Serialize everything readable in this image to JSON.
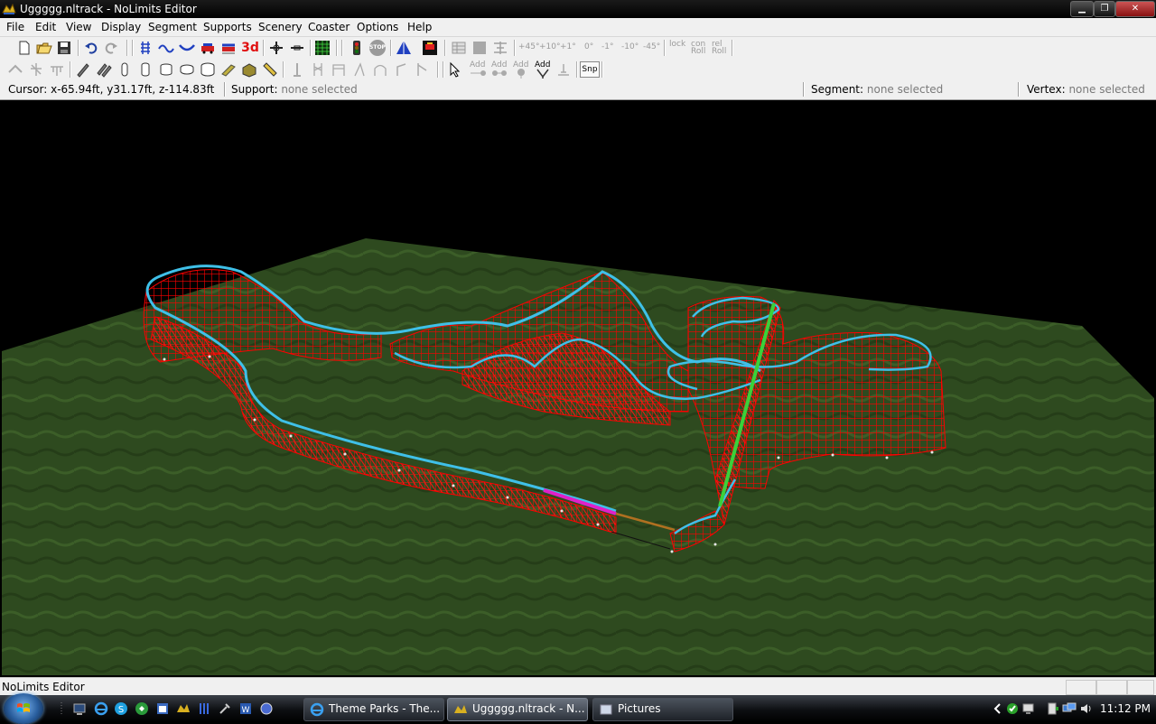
{
  "window": {
    "title": "Uggggg.nltrack - NoLimits Editor"
  },
  "menu": [
    "File",
    "Edit",
    "View",
    "Display",
    "Segment",
    "Supports",
    "Scenery",
    "Coaster",
    "Options",
    "Help"
  ],
  "toolbar": {
    "view3d_label": "3d",
    "stop_label": "STOP",
    "angle_labels": [
      "+45°",
      "+10°",
      "+1°",
      "0°",
      "-1°",
      "-10°",
      "-45°"
    ],
    "roll_labels": [
      "lock",
      "con Roll",
      "rel Roll"
    ],
    "add_labels": [
      "Add",
      "Add",
      "Add",
      "Add"
    ],
    "snap_label": "Snp"
  },
  "infobar": {
    "cursor_label": "Cursor:",
    "cursor_value": "x-65.94ft, y31.17ft, z-114.83ft",
    "support_label": "Support:",
    "support_value": "none selected",
    "segment_label": "Segment:",
    "segment_value": "none selected",
    "vertex_label": "Vertex:",
    "vertex_value": "none selected"
  },
  "status": {
    "text": "NoLimits Editor"
  },
  "taskbar": {
    "tasks": [
      "Theme Parks - The...",
      "Uggggg.nltrack - N...",
      "Pictures"
    ],
    "clock": "11:12 PM"
  },
  "colors": {
    "ground": "#2f4a1e",
    "supports": "#ff0000",
    "track": "#3fc0e8",
    "lift": "#3ad13a",
    "station": "#e020c8"
  }
}
